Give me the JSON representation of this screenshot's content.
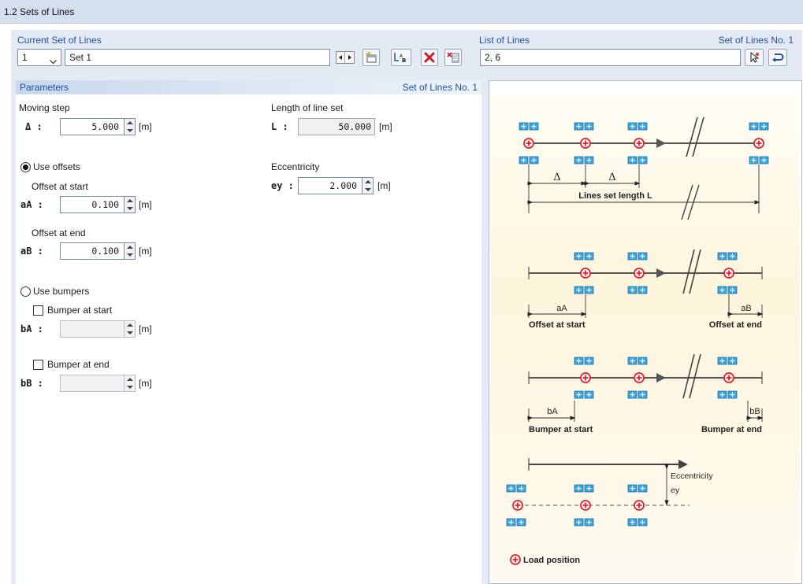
{
  "title": "1.2 Sets of Lines",
  "current_set": {
    "heading": "Current Set of Lines",
    "number": "1",
    "name": "Set 1"
  },
  "list_of_lines": {
    "heading": "List of Lines",
    "set_label": "Set of Lines No. 1",
    "value": "2, 6"
  },
  "parameters": {
    "heading": "Parameters",
    "set_label": "Set of Lines No. 1",
    "moving_step_label": "Moving step",
    "delta_symbol": "Δ :",
    "delta_value": "5.000",
    "unit_m": "[m]",
    "length_label": "Length of line set",
    "length_symbol": "L :",
    "length_value": "50.000",
    "use_offsets_label": "Use offsets",
    "offset_start_label": "Offset at start",
    "aA_symbol": "aA :",
    "aA_value": "0.100",
    "offset_end_label": "Offset at end",
    "aB_symbol": "aB :",
    "aB_value": "0.100",
    "eccentricity_label": "Eccentricity",
    "ey_symbol": "ey :",
    "ey_value": "2.000",
    "use_bumpers_label": "Use bumpers",
    "bumper_start_label": "Bumper at start",
    "bA_symbol": "bA :",
    "bumper_end_label": "Bumper at end",
    "bB_symbol": "bB :",
    "offsets_selected": true,
    "bumper_start_checked": false,
    "bumper_end_checked": false
  },
  "diagram": {
    "delta": "Δ",
    "lines_set_length": "Lines set length L",
    "aA": "aA",
    "aB": "aB",
    "offset_at_start": "Offset at start",
    "offset_at_end": "Offset at end",
    "bA": "bA",
    "bB": "bB",
    "bumper_at_start": "Bumper at start",
    "bumper_at_end": "Bumper at end",
    "eccentricity": "Eccentricity",
    "ey": "ey",
    "load_position": "Load position",
    "colors": {
      "load_marker": "#e0202a",
      "axle_box": "#3aa6e0",
      "line": "#555555"
    }
  }
}
